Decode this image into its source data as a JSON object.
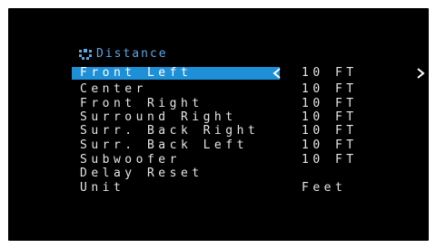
{
  "menu": {
    "title": "Distance",
    "title_icon": "speaker-grid-icon",
    "accent_color": "#5aa6e6",
    "highlight_color": "#1e90d8",
    "rows": [
      {
        "label": "Front Left",
        "value": "10 FT",
        "selected": true
      },
      {
        "label": "Center",
        "value": "10 FT"
      },
      {
        "label": "Front Right",
        "value": "10 FT"
      },
      {
        "label": "Surround Right",
        "value": "10 FT"
      },
      {
        "label": "Surr. Back Right",
        "value": "10 FT"
      },
      {
        "label": "Surr. Back Left",
        "value": "10 FT"
      },
      {
        "label": "Subwoofer",
        "value": "10 FT"
      },
      {
        "label": "Delay Reset",
        "value": ""
      },
      {
        "label": "Unit",
        "value": "Feet"
      }
    ]
  }
}
